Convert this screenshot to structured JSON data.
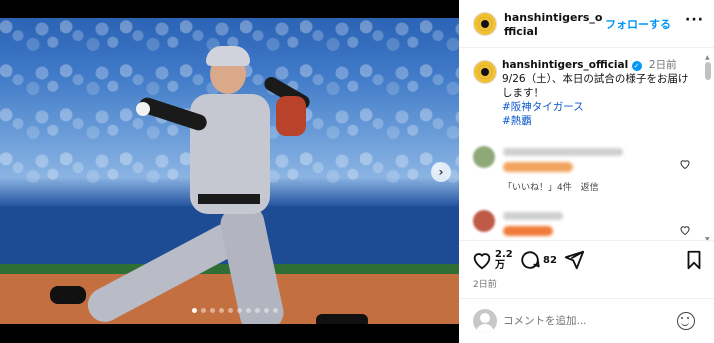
{
  "post": {
    "carousel": {
      "total": 10,
      "active_index": 0,
      "next_arrow": "›"
    }
  },
  "header": {
    "username": "hanshintigers_official",
    "follow_label": "フォローする",
    "more_label": "···"
  },
  "caption": {
    "username": "hanshintigers_official",
    "verified_mark": "✓",
    "time": "2日前",
    "text": "9/26（土）、本日の試合の様子をお届けします！",
    "hashtags": [
      "#阪神タイガース",
      "#熱覇"
    ]
  },
  "comments": {
    "first_likes_text": "「いいね！」4件",
    "reply_label": "返信"
  },
  "actions": {
    "likes_count_line1": "2.2",
    "likes_count_line2": "万",
    "comments_count": "82",
    "time": "2日前"
  },
  "comment_input": {
    "placeholder": "コメントを追加..."
  },
  "colors": {
    "accent_blue": "#0095f6",
    "brand_yellow": "#f0c233"
  }
}
